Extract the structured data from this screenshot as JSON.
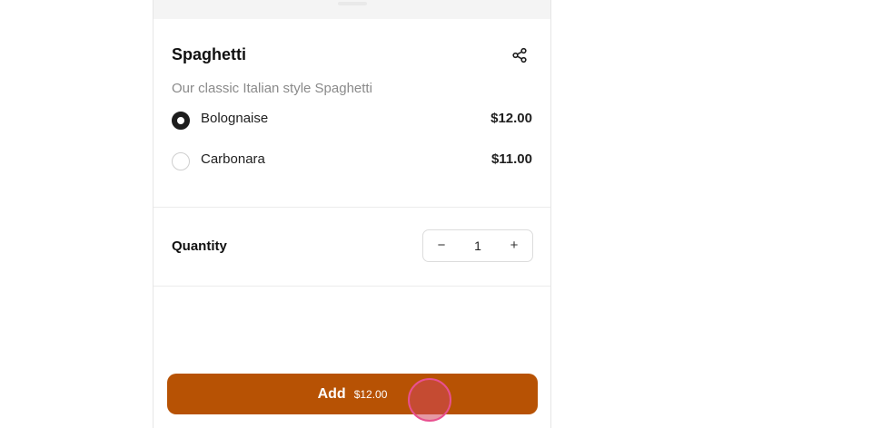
{
  "item": {
    "title": "Spaghetti",
    "description": "Our classic Italian style Spaghetti"
  },
  "icons": {
    "share": "share-icon"
  },
  "options": [
    {
      "label": "Bolognaise",
      "price": "$12.00",
      "selected": true
    },
    {
      "label": "Carbonara",
      "price": "$11.00",
      "selected": false
    }
  ],
  "quantity": {
    "label": "Quantity",
    "value": "1",
    "decrement_symbol": "−",
    "increment_symbol": "+"
  },
  "add_button": {
    "label": "Add",
    "price": "$12.00"
  },
  "colors": {
    "accent": "#b75204",
    "touch_indicator": "#e8508f"
  }
}
